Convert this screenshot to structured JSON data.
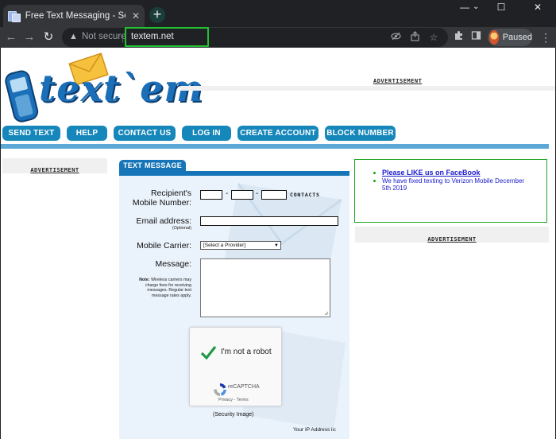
{
  "browser": {
    "tab_title": "Free Text Messaging - Send and Receive",
    "tab_close": "✕",
    "new_tab": "+",
    "win_minimize": "—",
    "win_maximize": "☐",
    "win_close": "✕",
    "security_label": "Not secure",
    "url": "textem.net",
    "profile_status": "Paused",
    "icons": [
      "back-arrow-icon",
      "forward-arrow-icon",
      "reload-icon",
      "warning-icon",
      "eye-off-icon",
      "share-icon",
      "star-icon",
      "extensions-icon",
      "side-panel-icon",
      "kebab-menu-icon"
    ],
    "highlight_color": "#22c232"
  },
  "site": {
    "logo_text": "text`em",
    "top_ad_label": "ADVERTISEMENT",
    "nav": [
      "SEND TEXT",
      "HELP",
      "CONTACT US",
      "LOG IN",
      "CREATE ACCOUNT",
      "BLOCK NUMBER"
    ],
    "left_ad_label": "ADVERTISEMENT",
    "brand_blue": "#1687ba"
  },
  "form": {
    "tab_label": "TEXT MESSAGE",
    "recipient_label": "Recipient's",
    "recipient_label2": "Mobile Number:",
    "dash": "-",
    "contacts_label": "CONTACTS",
    "email_label": "Email address:",
    "email_optional": "(Optional)",
    "carrier_label": "Mobile Carrier:",
    "carrier_selected": "[Select a Provider]",
    "message_label": "Message:",
    "note_bold": "Note:",
    "note_text": " Wireless carriers may charge fees for receiving messages. Regular text message rates apply.",
    "captcha_text": "I'm not a robot",
    "captcha_brand": "reCAPTCHA",
    "captcha_links": "Privacy - Terms",
    "security_caption": "(Security Image)",
    "ip_label": "Your IP Address is:"
  },
  "notice": {
    "items": [
      "Please LIKE us on FaceBook",
      "We have fixed texting to Verizon Mobile December 5th 2019"
    ],
    "border_color": "#1da51d"
  },
  "right_ad_label": "ADVERTISEMENT"
}
